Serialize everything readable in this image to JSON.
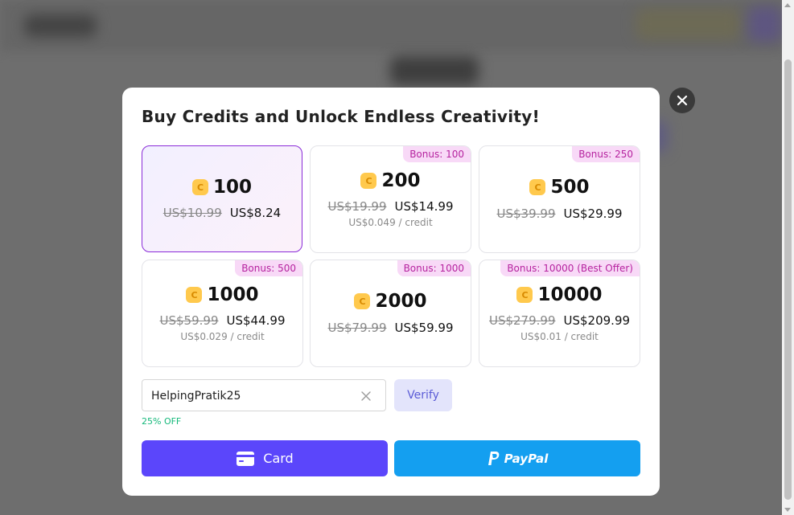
{
  "modal": {
    "title": "Buy Credits and Unlock Endless Creativity!",
    "close_icon": "close-icon"
  },
  "packages": [
    {
      "amount": "100",
      "old_price": "US$10.99",
      "new_price": "US$8.24",
      "per_credit": "",
      "bonus": "",
      "selected": true
    },
    {
      "amount": "200",
      "old_price": "US$19.99",
      "new_price": "US$14.99",
      "per_credit": "US$0.049 / credit",
      "bonus": "Bonus: 100",
      "selected": false
    },
    {
      "amount": "500",
      "old_price": "US$39.99",
      "new_price": "US$29.99",
      "per_credit": "",
      "bonus": "Bonus: 250",
      "selected": false
    },
    {
      "amount": "1000",
      "old_price": "US$59.99",
      "new_price": "US$44.99",
      "per_credit": "US$0.029 / credit",
      "bonus": "Bonus: 500",
      "selected": false
    },
    {
      "amount": "2000",
      "old_price": "US$79.99",
      "new_price": "US$59.99",
      "per_credit": "",
      "bonus": "Bonus: 1000",
      "selected": false
    },
    {
      "amount": "10000",
      "old_price": "US$279.99",
      "new_price": "US$209.99",
      "per_credit": "US$0.01 / credit",
      "bonus": "Bonus: 10000 (Best Offer)",
      "selected": false
    }
  ],
  "coin_symbol": "C",
  "coupon": {
    "value": "HelpingPratik25",
    "verify_label": "Verify",
    "discount_text": "25% OFF"
  },
  "payment": {
    "card_label": "Card",
    "paypal_label": "PayPal"
  },
  "colors": {
    "accent": "#5b46fb",
    "paypal": "#149ff0",
    "bonus_text": "#b6239f",
    "bonus_bg": "#f8d9f7",
    "discount": "#14b87a",
    "coin": "#ffc94d"
  }
}
